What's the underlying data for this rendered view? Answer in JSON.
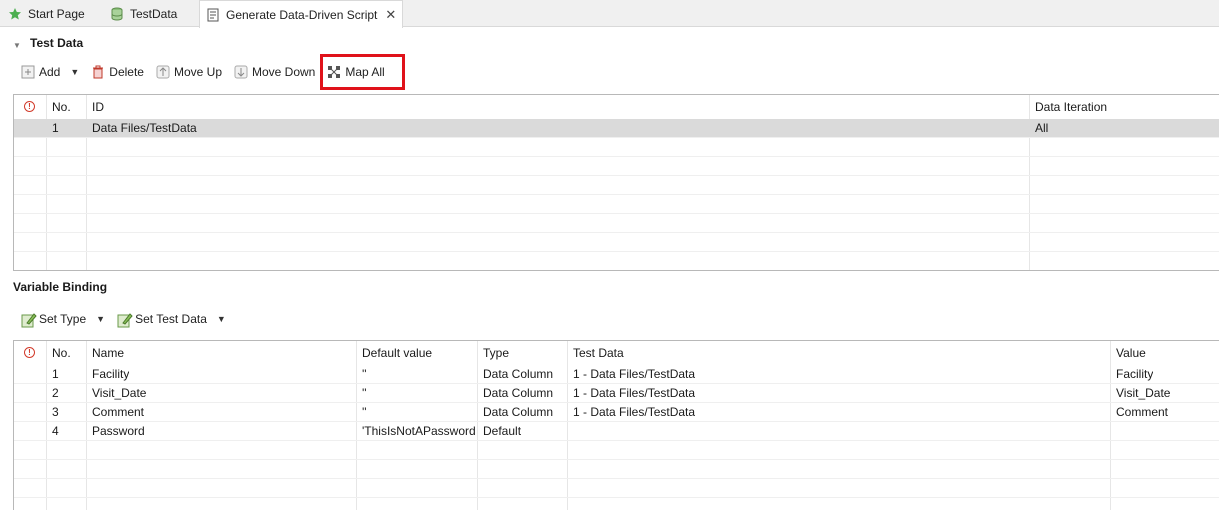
{
  "tabs": [
    {
      "label": "Start Page",
      "icon": "star-icon"
    },
    {
      "label": "TestData",
      "icon": "database-icon"
    },
    {
      "label": "Generate Data-Driven Script",
      "icon": "script-icon",
      "close": "✕"
    }
  ],
  "test_data": {
    "title": "Test Data",
    "toolbar": {
      "add": "Add",
      "delete": "Delete",
      "move_up": "Move Up",
      "move_down": "Move Down",
      "map_all": "Map All"
    },
    "columns": [
      "No.",
      "ID",
      "Data Iteration"
    ],
    "rows": [
      {
        "no": "1",
        "id": "Data Files/TestData",
        "iteration": "All"
      }
    ]
  },
  "variable_binding": {
    "title": "Variable Binding",
    "toolbar": {
      "set_type": "Set Type",
      "set_test_data": "Set Test Data"
    },
    "columns": [
      "No.",
      "Name",
      "Default value",
      "Type",
      "Test Data",
      "Value"
    ],
    "rows": [
      {
        "no": "1",
        "name": "Facility",
        "default": "''",
        "type": "Data Column",
        "test_data": "1 - Data Files/TestData",
        "value": "Facility"
      },
      {
        "no": "2",
        "name": "Visit_Date",
        "default": "''",
        "type": "Data Column",
        "test_data": "1 - Data Files/TestData",
        "value": "Visit_Date"
      },
      {
        "no": "3",
        "name": "Comment",
        "default": "''",
        "type": "Data Column",
        "test_data": "1 - Data Files/TestData",
        "value": "Comment"
      },
      {
        "no": "4",
        "name": "Password",
        "default": "'ThisIsNotAPassword",
        "type": "Default",
        "test_data": "",
        "value": ""
      }
    ]
  },
  "colors": {
    "highlight": "#e0121a",
    "selected_row": "#dadada",
    "warn": "#d23b2b"
  }
}
